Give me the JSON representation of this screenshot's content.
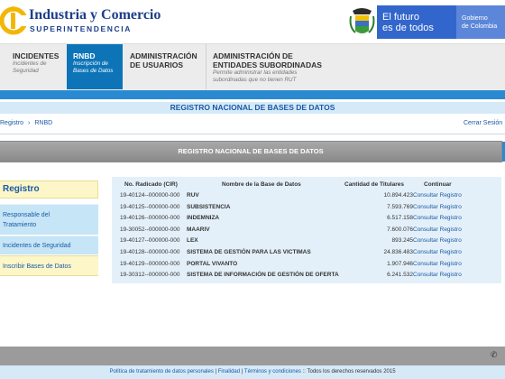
{
  "header": {
    "brand_line1": "Industria y Comercio",
    "brand_line2": "SUPERINTENDENCIA",
    "gov_tagline_1": "El futuro",
    "gov_tagline_2": "es de todos",
    "gov_right_1": "Gobierno",
    "gov_right_2": "de Colombia",
    "colors": {
      "brand": "#1d3f8a",
      "gov_blue": "#3366cc",
      "accent": "#0d74b8"
    }
  },
  "nav": [
    {
      "title": "INCIDENTES",
      "sub1": "Incidentes de",
      "sub2": "Seguridad",
      "active": false
    },
    {
      "title": "RNBD",
      "sub1": "Inscripción de",
      "sub2": "Bases de Datos",
      "active": true
    },
    {
      "title": "ADMINISTRACIÓN",
      "sub1": "DE USUARIOS",
      "sub2": "",
      "active": false
    },
    {
      "title": "ADMINISTRACIÓN DE",
      "sub1": "ENTIDADES SUBORDINADAS",
      "sub2": "Permite administrar las entidades",
      "sub3": "subordinadas que no tienen RUT",
      "active": false
    }
  ],
  "page_title": "REGISTRO NACIONAL DE BASES DE DATOS",
  "breadcrumb": {
    "item1": "Registro",
    "sep": "›",
    "item2": "RNBD"
  },
  "logout_label": "Cerrar Sesión",
  "section_bar_title": "REGISTRO NACIONAL DE BASES DE DATOS",
  "sidebar": {
    "heading": "Registro",
    "items": [
      {
        "label_1": "Responsable del",
        "label_2": "Tratamiento"
      },
      {
        "label_1": "Incidentes de Seguridad"
      },
      {
        "label_1": "Inscribir Bases de Datos"
      }
    ]
  },
  "table": {
    "headers": [
      "No. Radicado (CIR)",
      "Nombre de la Base de Datos",
      "Cantidad de Titulares",
      "Continuar"
    ],
    "rows": [
      {
        "radicado": "19-40124--000000-000",
        "name": "RUV",
        "count": "10.894.423",
        "link": "Consultar Registro"
      },
      {
        "radicado": "19-40125--000000-000",
        "name": "SUBSISTENCIA",
        "count": "7.593.769",
        "link": "Consultar Registro"
      },
      {
        "radicado": "19-40126--000000-000",
        "name": "INDEMNIZA",
        "count": "6.517.158",
        "link": "Consultar Registro"
      },
      {
        "radicado": "19-30052--000000-000",
        "name": "MAARIV",
        "count": "7.600.076",
        "link": "Consultar Registro"
      },
      {
        "radicado": "19-40127--000000-000",
        "name": "LEX",
        "count": "893.245",
        "link": "Consultar Registro"
      },
      {
        "radicado": "19-40128--000000-000",
        "name": "SISTEMA DE GESTIÓN PARA LAS VICTIMAS",
        "count": "24.836.483",
        "link": "Consultar Registro"
      },
      {
        "radicado": "19-40129--000000-000",
        "name": "PORTAL VIVANTO",
        "count": "1.907.946",
        "link": "Consultar Registro"
      },
      {
        "radicado": "19-30312--000000-000",
        "name": "SISTEMA DE INFORMACIÓN DE GESTIÓN DE OFERTA",
        "count": "6.241.532",
        "link": "Consultar Registro"
      }
    ]
  },
  "footer": {
    "link1": "Política de tratamiento de datos personales",
    "sep1": " | ",
    "link2": "Finalidad",
    "sep2": " | ",
    "link3": "Términos y condiciones",
    "rights": " :: Todos los derechos reservados 2015",
    "icon": "phone-icon"
  }
}
